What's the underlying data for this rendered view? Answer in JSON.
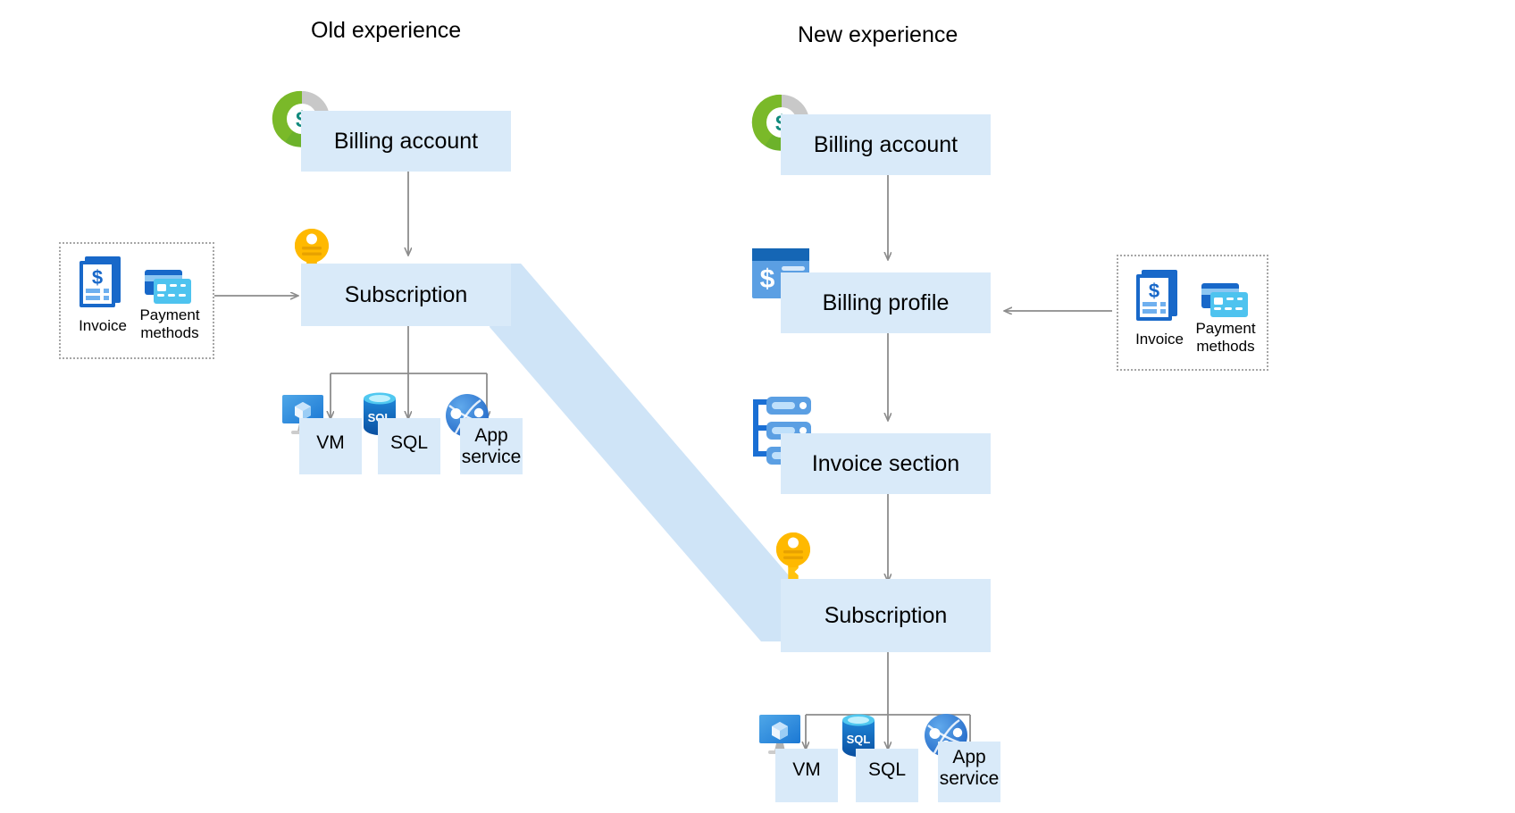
{
  "diagram": {
    "title_left": "Old experience",
    "title_right": "New experience",
    "colors": {
      "node_fill": "#d9eaf9",
      "band_fill": "#cfe4f7",
      "arrow_stroke": "#8c8c8c",
      "dashed_border": "#a6a6a6",
      "azure_blue": "#0078d4",
      "key_yellow": "#ffc20e",
      "money_green": "#7ab929",
      "money_gray": "#c8c8c8",
      "money_yellow": "#ffca00",
      "money_dollar": "#128a7d"
    },
    "left": {
      "billing_account": "Billing account",
      "subscription": "Subscription",
      "resources": [
        {
          "label": "VM",
          "icon": "vm-icon"
        },
        {
          "label": "SQL",
          "icon": "sql-icon"
        },
        {
          "label": "App\nservice",
          "icon": "app-service-icon"
        }
      ],
      "payment_group": {
        "invoice": "Invoice",
        "payment_methods": "Payment\nmethods"
      }
    },
    "right": {
      "billing_account": "Billing account",
      "billing_profile": "Billing profile",
      "invoice_section": "Invoice section",
      "subscription": "Subscription",
      "resources": [
        {
          "label": "VM",
          "icon": "vm-icon"
        },
        {
          "label": "SQL",
          "icon": "sql-icon"
        },
        {
          "label": "App\nservice",
          "icon": "app-service-icon"
        }
      ],
      "payment_group": {
        "invoice": "Invoice",
        "payment_methods": "Payment\nmethods"
      }
    }
  }
}
